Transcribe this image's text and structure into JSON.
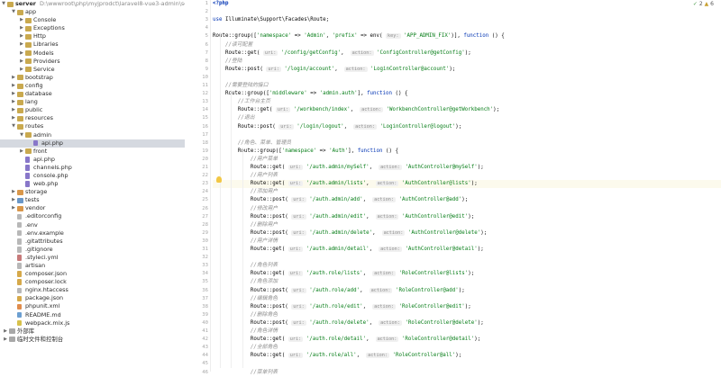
{
  "project": {
    "root_name": "server",
    "root_path": "D:\\wwwroot\\php\\myjprodct\\laravel8-vue3-admin\\server"
  },
  "tree": [
    {
      "label": "app",
      "depth": 1,
      "type": "folder",
      "open": true
    },
    {
      "label": "Console",
      "depth": 2,
      "type": "folder",
      "open": false
    },
    {
      "label": "Exceptions",
      "depth": 2,
      "type": "folder",
      "open": false
    },
    {
      "label": "Http",
      "depth": 2,
      "type": "folder",
      "open": false
    },
    {
      "label": "Libraries",
      "depth": 2,
      "type": "folder",
      "open": false
    },
    {
      "label": "Models",
      "depth": 2,
      "type": "folder",
      "open": false
    },
    {
      "label": "Providers",
      "depth": 2,
      "type": "folder",
      "open": false
    },
    {
      "label": "Service",
      "depth": 2,
      "type": "folder",
      "open": false
    },
    {
      "label": "bootstrap",
      "depth": 1,
      "type": "folder",
      "open": false
    },
    {
      "label": "config",
      "depth": 1,
      "type": "folder",
      "open": false
    },
    {
      "label": "database",
      "depth": 1,
      "type": "folder",
      "open": false
    },
    {
      "label": "lang",
      "depth": 1,
      "type": "folder",
      "open": false
    },
    {
      "label": "public",
      "depth": 1,
      "type": "folder",
      "open": false
    },
    {
      "label": "resources",
      "depth": 1,
      "type": "folder",
      "open": false
    },
    {
      "label": "routes",
      "depth": 1,
      "type": "folder",
      "open": true
    },
    {
      "label": "admin",
      "depth": 2,
      "type": "folder",
      "open": true
    },
    {
      "label": "api.php",
      "depth": 3,
      "type": "php",
      "selected": true
    },
    {
      "label": "front",
      "depth": 2,
      "type": "folder",
      "open": false
    },
    {
      "label": "api.php",
      "depth": 2,
      "type": "php"
    },
    {
      "label": "channels.php",
      "depth": 2,
      "type": "php"
    },
    {
      "label": "console.php",
      "depth": 2,
      "type": "php"
    },
    {
      "label": "web.php",
      "depth": 2,
      "type": "php"
    },
    {
      "label": "storage",
      "depth": 1,
      "type": "folder-orange",
      "open": false
    },
    {
      "label": "tests",
      "depth": 1,
      "type": "folder-blue",
      "open": false
    },
    {
      "label": "vendor",
      "depth": 1,
      "type": "folder-orange",
      "open": false
    },
    {
      "label": ".editorconfig",
      "depth": 1,
      "type": "txt"
    },
    {
      "label": ".env",
      "depth": 1,
      "type": "txt"
    },
    {
      "label": ".env.example",
      "depth": 1,
      "type": "txt"
    },
    {
      "label": ".gitattributes",
      "depth": 1,
      "type": "txt"
    },
    {
      "label": ".gitignore",
      "depth": 1,
      "type": "txt"
    },
    {
      "label": ".styleci.yml",
      "depth": 1,
      "type": "yml"
    },
    {
      "label": "artisan",
      "depth": 1,
      "type": "txt"
    },
    {
      "label": "composer.json",
      "depth": 1,
      "type": "json"
    },
    {
      "label": "composer.lock",
      "depth": 1,
      "type": "json"
    },
    {
      "label": "nginx.htaccess",
      "depth": 1,
      "type": "txt"
    },
    {
      "label": "package.json",
      "depth": 1,
      "type": "json"
    },
    {
      "label": "phpunit.xml",
      "depth": 1,
      "type": "xml"
    },
    {
      "label": "README.md",
      "depth": 1,
      "type": "md"
    },
    {
      "label": "webpack.mix.js",
      "depth": 1,
      "type": "js"
    },
    {
      "label": "外部库",
      "depth": 0,
      "type": "lib",
      "open": false
    },
    {
      "label": "临时文件和控制台",
      "depth": 0,
      "type": "lib",
      "open": false
    }
  ],
  "editor": {
    "inspection": {
      "ok": "2",
      "warn": "6"
    },
    "current_line": 13,
    "lines": [
      [
        {
          "t": "<?php",
          "c": "php"
        }
      ],
      [],
      [
        {
          "t": "use ",
          "c": "kw"
        },
        {
          "t": "Illuminate\\Support\\Facades\\Route;"
        }
      ],
      [],
      [
        {
          "t": "Route::group(["
        },
        {
          "t": "'namespace'",
          "c": "str"
        },
        {
          "t": " => "
        },
        {
          "t": "'Admin'",
          "c": "str"
        },
        {
          "t": ", "
        },
        {
          "t": "'prefix'",
          "c": "str"
        },
        {
          "t": " => env( "
        },
        {
          "t": "key:",
          "c": "hint"
        },
        {
          "t": " "
        },
        {
          "t": "'APP_ADMIN_FIX'",
          "c": "str"
        },
        {
          "t": ")], "
        },
        {
          "t": "function",
          "c": "kw"
        },
        {
          "t": " () {"
        }
      ],
      [
        {
          "t": "    "
        },
        {
          "t": "//读可配置",
          "c": "cmt"
        }
      ],
      [
        {
          "t": "    Route::get( "
        },
        {
          "t": "uri:",
          "c": "hint"
        },
        {
          "t": " "
        },
        {
          "t": "'/config/getConfig'",
          "c": "str"
        },
        {
          "t": ",  "
        },
        {
          "t": "action:",
          "c": "hint"
        },
        {
          "t": " "
        },
        {
          "t": "'ConfigController@getConfig'",
          "c": "str"
        },
        {
          "t": ");"
        }
      ],
      [
        {
          "t": "    "
        },
        {
          "t": "//登陆",
          "c": "cmt"
        }
      ],
      [
        {
          "t": "    Route::post( "
        },
        {
          "t": "uri:",
          "c": "hint"
        },
        {
          "t": " "
        },
        {
          "t": "'/login/account'",
          "c": "str"
        },
        {
          "t": ",  "
        },
        {
          "t": "action:",
          "c": "hint"
        },
        {
          "t": " "
        },
        {
          "t": "'LoginController@account'",
          "c": "str"
        },
        {
          "t": ");"
        }
      ],
      [],
      [
        {
          "t": "    "
        },
        {
          "t": "//需要登陆的接口",
          "c": "cmt"
        }
      ],
      [
        {
          "t": "    Route::group(["
        },
        {
          "t": "'middleware'",
          "c": "str"
        },
        {
          "t": " => "
        },
        {
          "t": "'admin.auth'",
          "c": "str"
        },
        {
          "t": "], "
        },
        {
          "t": "function",
          "c": "kw"
        },
        {
          "t": " () {"
        }
      ],
      [
        {
          "t": "        "
        },
        {
          "t": "//工作台主页",
          "c": "cmt"
        }
      ],
      [
        {
          "t": "        Route::get( "
        },
        {
          "t": "uri:",
          "c": "hint"
        },
        {
          "t": " "
        },
        {
          "t": "'/workbench/index'",
          "c": "str"
        },
        {
          "t": ",  "
        },
        {
          "t": "action:",
          "c": "hint"
        },
        {
          "t": " "
        },
        {
          "t": "'WorkbenchController@getWorkbench'",
          "c": "str"
        },
        {
          "t": ");"
        }
      ],
      [
        {
          "t": "        "
        },
        {
          "t": "//退出",
          "c": "cmt"
        }
      ],
      [
        {
          "t": "        Route::post( "
        },
        {
          "t": "uri:",
          "c": "hint"
        },
        {
          "t": " "
        },
        {
          "t": "'/login/logout'",
          "c": "str"
        },
        {
          "t": ",  "
        },
        {
          "t": "action:",
          "c": "hint"
        },
        {
          "t": " "
        },
        {
          "t": "'LoginController@logout'",
          "c": "str"
        },
        {
          "t": ");"
        }
      ],
      [],
      [
        {
          "t": "        "
        },
        {
          "t": "//角色、菜单、管理员",
          "c": "cmt"
        }
      ],
      [
        {
          "t": "        Route::group(["
        },
        {
          "t": "'namespace'",
          "c": "str"
        },
        {
          "t": " => "
        },
        {
          "t": "'Auth'",
          "c": "str"
        },
        {
          "t": "], "
        },
        {
          "t": "function",
          "c": "kw"
        },
        {
          "t": " () {"
        }
      ],
      [
        {
          "t": "            "
        },
        {
          "t": "//用户菜单",
          "c": "cmt"
        }
      ],
      [
        {
          "t": "            Route::get( "
        },
        {
          "t": "uri:",
          "c": "hint"
        },
        {
          "t": " "
        },
        {
          "t": "'/auth.admin/mySelf'",
          "c": "str"
        },
        {
          "t": ",  "
        },
        {
          "t": "action:",
          "c": "hint"
        },
        {
          "t": " "
        },
        {
          "t": "'AuthController@mySelf'",
          "c": "str"
        },
        {
          "t": ");"
        }
      ],
      [
        {
          "t": "            "
        },
        {
          "t": "//用户列表",
          "c": "cmt"
        }
      ],
      [
        {
          "t": "            Route::get( "
        },
        {
          "t": "uri:",
          "c": "hint"
        },
        {
          "t": " "
        },
        {
          "t": "'/auth.admin/lists'",
          "c": "str"
        },
        {
          "t": ",  "
        },
        {
          "t": "action:",
          "c": "hint"
        },
        {
          "t": " "
        },
        {
          "t": "'AuthController@lists'",
          "c": "str"
        },
        {
          "t": ");"
        }
      ],
      [
        {
          "t": "            "
        },
        {
          "t": "//添加用户",
          "c": "cmt"
        }
      ],
      [
        {
          "t": "            Route::post( "
        },
        {
          "t": "uri:",
          "c": "hint"
        },
        {
          "t": " "
        },
        {
          "t": "'/auth.admin/add'",
          "c": "str"
        },
        {
          "t": ",  "
        },
        {
          "t": "action:",
          "c": "hint"
        },
        {
          "t": " "
        },
        {
          "t": "'AuthController@add'",
          "c": "str"
        },
        {
          "t": ");"
        }
      ],
      [
        {
          "t": "            "
        },
        {
          "t": "//修改用户",
          "c": "cmt"
        }
      ],
      [
        {
          "t": "            Route::post( "
        },
        {
          "t": "uri:",
          "c": "hint"
        },
        {
          "t": " "
        },
        {
          "t": "'/auth.admin/edit'",
          "c": "str"
        },
        {
          "t": ",  "
        },
        {
          "t": "action:",
          "c": "hint"
        },
        {
          "t": " "
        },
        {
          "t": "'AuthController@edit'",
          "c": "str"
        },
        {
          "t": ");"
        }
      ],
      [
        {
          "t": "            "
        },
        {
          "t": "//删除用户",
          "c": "cmt"
        }
      ],
      [
        {
          "t": "            Route::post( "
        },
        {
          "t": "uri:",
          "c": "hint"
        },
        {
          "t": " "
        },
        {
          "t": "'/auth.admin/delete'",
          "c": "str"
        },
        {
          "t": ",  "
        },
        {
          "t": "action:",
          "c": "hint"
        },
        {
          "t": " "
        },
        {
          "t": "'AuthController@delete'",
          "c": "str"
        },
        {
          "t": ");"
        }
      ],
      [
        {
          "t": "            "
        },
        {
          "t": "//用户详情",
          "c": "cmt"
        }
      ],
      [
        {
          "t": "            Route::get( "
        },
        {
          "t": "uri:",
          "c": "hint"
        },
        {
          "t": " "
        },
        {
          "t": "'/auth.admin/detail'",
          "c": "str"
        },
        {
          "t": ",  "
        },
        {
          "t": "action:",
          "c": "hint"
        },
        {
          "t": " "
        },
        {
          "t": "'AuthController@detail'",
          "c": "str"
        },
        {
          "t": ");"
        }
      ],
      [],
      [
        {
          "t": "            "
        },
        {
          "t": "//角色列表",
          "c": "cmt"
        }
      ],
      [
        {
          "t": "            Route::get( "
        },
        {
          "t": "uri:",
          "c": "hint"
        },
        {
          "t": " "
        },
        {
          "t": "'/auth.role/lists'",
          "c": "str"
        },
        {
          "t": ",  "
        },
        {
          "t": "action:",
          "c": "hint"
        },
        {
          "t": " "
        },
        {
          "t": "'RoleController@lists'",
          "c": "str"
        },
        {
          "t": ");"
        }
      ],
      [
        {
          "t": "            "
        },
        {
          "t": "//角色添加",
          "c": "cmt"
        }
      ],
      [
        {
          "t": "            Route::post( "
        },
        {
          "t": "uri:",
          "c": "hint"
        },
        {
          "t": " "
        },
        {
          "t": "'/auth.role/add'",
          "c": "str"
        },
        {
          "t": ",  "
        },
        {
          "t": "action:",
          "c": "hint"
        },
        {
          "t": " "
        },
        {
          "t": "'RoleController@add'",
          "c": "str"
        },
        {
          "t": ");"
        }
      ],
      [
        {
          "t": "            "
        },
        {
          "t": "//编辑角色",
          "c": "cmt"
        }
      ],
      [
        {
          "t": "            Route::post( "
        },
        {
          "t": "uri:",
          "c": "hint"
        },
        {
          "t": " "
        },
        {
          "t": "'/auth.role/edit'",
          "c": "str"
        },
        {
          "t": ",  "
        },
        {
          "t": "action:",
          "c": "hint"
        },
        {
          "t": " "
        },
        {
          "t": "'RoleController@edit'",
          "c": "str"
        },
        {
          "t": ");"
        }
      ],
      [
        {
          "t": "            "
        },
        {
          "t": "//删除角色",
          "c": "cmt"
        }
      ],
      [
        {
          "t": "            Route::post( "
        },
        {
          "t": "uri:",
          "c": "hint"
        },
        {
          "t": " "
        },
        {
          "t": "'/auth.role/delete'",
          "c": "str"
        },
        {
          "t": ",  "
        },
        {
          "t": "action:",
          "c": "hint"
        },
        {
          "t": " "
        },
        {
          "t": "'RoleController@delete'",
          "c": "str"
        },
        {
          "t": ");"
        }
      ],
      [
        {
          "t": "            "
        },
        {
          "t": "//角色详情",
          "c": "cmt"
        }
      ],
      [
        {
          "t": "            Route::get( "
        },
        {
          "t": "uri:",
          "c": "hint"
        },
        {
          "t": " "
        },
        {
          "t": "'/auth.role/detail'",
          "c": "str"
        },
        {
          "t": ",  "
        },
        {
          "t": "action:",
          "c": "hint"
        },
        {
          "t": " "
        },
        {
          "t": "'RoleController@detail'",
          "c": "str"
        },
        {
          "t": ");"
        }
      ],
      [
        {
          "t": "            "
        },
        {
          "t": "//全部角色",
          "c": "cmt"
        }
      ],
      [
        {
          "t": "            Route::get( "
        },
        {
          "t": "uri:",
          "c": "hint"
        },
        {
          "t": " "
        },
        {
          "t": "'/auth.role/all'",
          "c": "str"
        },
        {
          "t": ",  "
        },
        {
          "t": "action:",
          "c": "hint"
        },
        {
          "t": " "
        },
        {
          "t": "'RoleController@all'",
          "c": "str"
        },
        {
          "t": ");"
        }
      ],
      [],
      [
        {
          "t": "            "
        },
        {
          "t": "//菜单列表",
          "c": "cmt"
        }
      ]
    ]
  }
}
